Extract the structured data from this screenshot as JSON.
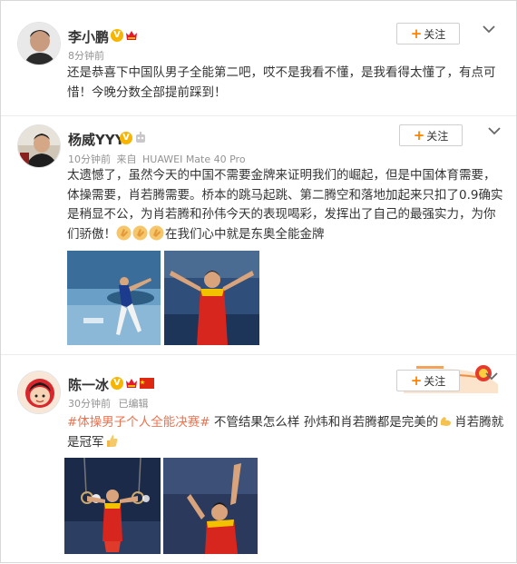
{
  "posts": [
    {
      "user": "李小鹏",
      "time": "8分钟前",
      "follow": "关注",
      "lines": [
        "还是恭喜下中国队男子全能第二吧，哎不是我看不懂，是我看得太懂了，有点可",
        "惜！今晚分数全部提前踩到！"
      ]
    },
    {
      "user": "杨威YYY",
      "time": "10分钟前",
      "source_prefix": "来自",
      "source": "HUAWEI Mate 40 Pro",
      "follow": "关注",
      "lines": [
        "太遗憾了，虽然今天的中国不需要金牌来证明我们的崛起，但是中国体育需要，",
        "体操需要，肖若腾需要。桥本的跳马起跳、第二腾空和落地加起来只扣了0.9确实",
        "是稍显不公，为肖若腾和孙伟今天的表现喝彩，发挥出了自己的最强实力，为你",
        "们骄傲！"
      ],
      "last_line_tail": "在我们心中就是东奥全能金牌"
    },
    {
      "user": "陈一冰",
      "time": "30分钟前",
      "edited": "已编辑",
      "follow": "关注",
      "hashtag": "#体操男子个人全能决赛#",
      "line1_rest": " 不管结果怎么样 孙炜和肖若腾都是完美的",
      "line1_tail": "肖若腾就",
      "line2": "是冠军"
    }
  ],
  "colors": {
    "accent": "#ff8200",
    "hashtag": "#eb7350",
    "meta": "#939393",
    "vip_orange": "#f7b500",
    "vip_red": "#e6162d"
  },
  "icons": [
    "vip-verified-icon",
    "vip-crown-icon",
    "china-flag-icon",
    "chevron-down-icon",
    "robot-badge-icon",
    "strong-arm-emoji",
    "thumbs-up-emoji",
    "clap-emoji"
  ]
}
